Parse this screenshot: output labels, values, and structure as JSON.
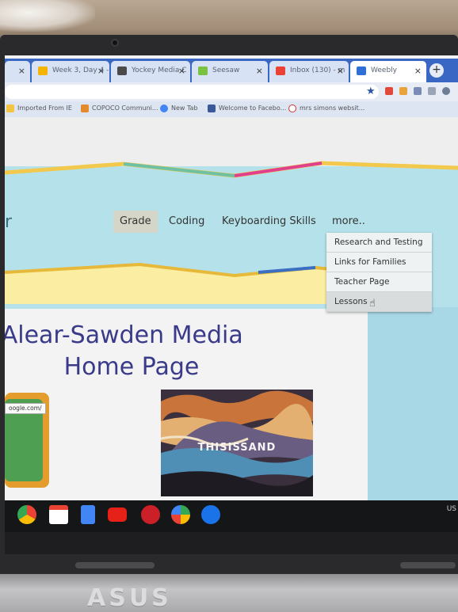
{
  "browser": {
    "tabs": [
      {
        "label": "Week 3, Day 4 -",
        "favicon_color": "#f4b400"
      },
      {
        "label": "Yockey Media C",
        "favicon_color": "#4a4a4a"
      },
      {
        "label": "Seesaw",
        "favicon_color": "#7ac142"
      },
      {
        "label": "Inbox (130) - m",
        "favicon_color": "#ea4335"
      },
      {
        "label": "Weebly",
        "favicon_color": "#2f6fd6"
      }
    ],
    "new_tab_label": "+",
    "bookmarks": [
      {
        "label": "Imported From IE",
        "icon_color": "#f4c542"
      },
      {
        "label": "COPOCO Communi...",
        "icon_color": "#e38b2c"
      },
      {
        "label": "New Tab",
        "icon_color": "#4285f4"
      },
      {
        "label": "Welcome to Facebo...",
        "icon_color": "#3b5998"
      },
      {
        "label": "mrs simons websit...",
        "icon_color": "#ffffff"
      }
    ]
  },
  "site": {
    "logo_fragment": "r",
    "nav": {
      "items": [
        "Grade",
        "Coding",
        "Keyboarding Skills",
        "more.."
      ],
      "active_index": 0
    },
    "dropdown": {
      "items": [
        "Research and Testing",
        "Links for Families",
        "Teacher Page",
        "Lessons"
      ],
      "hover_index": 3
    },
    "title_line1": "cAlear-Sawden Media",
    "title_line2": "Home Page",
    "left_image_url": "oogle.com/",
    "feature_image_text": "THISISSAND"
  },
  "shelf": {
    "apps": [
      "chrome-icon",
      "gmail-icon",
      "docs-icon",
      "youtube-icon",
      "pinterest-icon",
      "play-store-icon",
      "files-icon"
    ],
    "status_text": "US"
  },
  "laptop": {
    "brand": "ASUS"
  }
}
